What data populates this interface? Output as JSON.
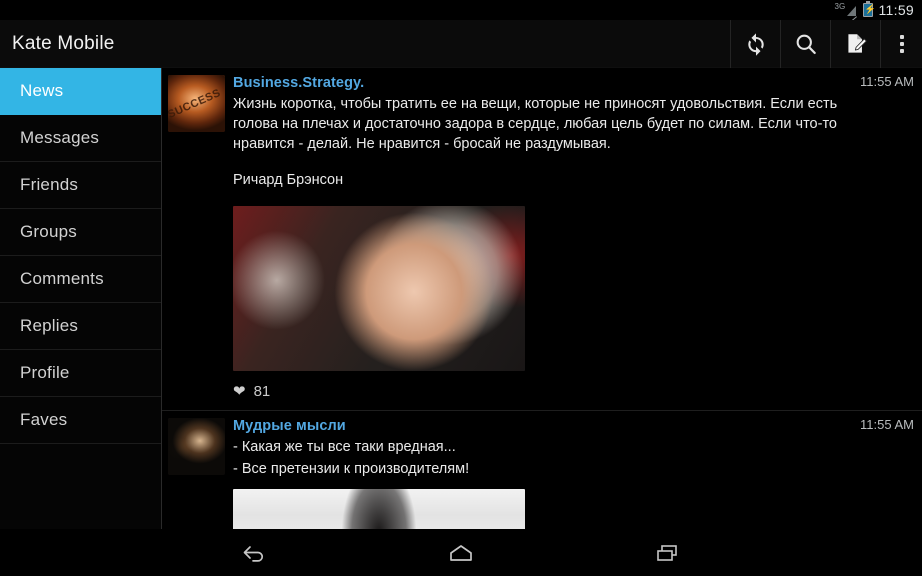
{
  "status_bar": {
    "network_label": "3G",
    "network_icon": "signal-3g-icon",
    "battery_icon": "battery-charging-icon",
    "time": "11:59"
  },
  "action_bar": {
    "title": "Kate Mobile",
    "buttons": [
      {
        "name": "refresh-button",
        "icon": "refresh-icon"
      },
      {
        "name": "search-button",
        "icon": "search-icon"
      },
      {
        "name": "compose-button",
        "icon": "compose-icon"
      },
      {
        "name": "overflow-button",
        "icon": "more-vertical-icon"
      }
    ]
  },
  "sidebar": {
    "active_color": "#33b5e5",
    "items": [
      {
        "label": "News",
        "active": true
      },
      {
        "label": "Messages",
        "active": false
      },
      {
        "label": "Friends",
        "active": false
      },
      {
        "label": "Groups",
        "active": false
      },
      {
        "label": "Comments",
        "active": false
      },
      {
        "label": "Replies",
        "active": false
      },
      {
        "label": "Profile",
        "active": false
      },
      {
        "label": "Faves",
        "active": false
      }
    ]
  },
  "feed": {
    "author_color": "#53a8e2",
    "posts": [
      {
        "author": "Business.Strategy.",
        "time": "11:55 AM",
        "avatar_icon": "avatar-success-image",
        "text": "Жизнь коротка, чтобы тратить ее на вещи, которые не приносят удовольствия. Если есть голова на плечах и достаточно задора в сердце, любая цель будет по силам. Если что-то нравится - делай. Не нравится - бросай не раздумывая.",
        "signature": "Ричард Брэнсон",
        "photo_icon": "post-photo-richard-branson",
        "like_icon": "heart-icon",
        "likes": "81"
      },
      {
        "author": "Мудрые мысли",
        "time": "11:55 AM",
        "avatar_icon": "avatar-old-man-image",
        "text_line1": "- Какая же ты все таки вредная...",
        "text_line2": "- Все претензии к производителям!",
        "photo_icon": "post-photo-woman"
      }
    ]
  },
  "nav_bar": {
    "buttons": [
      {
        "name": "back-button",
        "icon": "back-arrow-icon"
      },
      {
        "name": "home-button",
        "icon": "home-icon"
      },
      {
        "name": "recents-button",
        "icon": "recents-icon"
      }
    ]
  }
}
